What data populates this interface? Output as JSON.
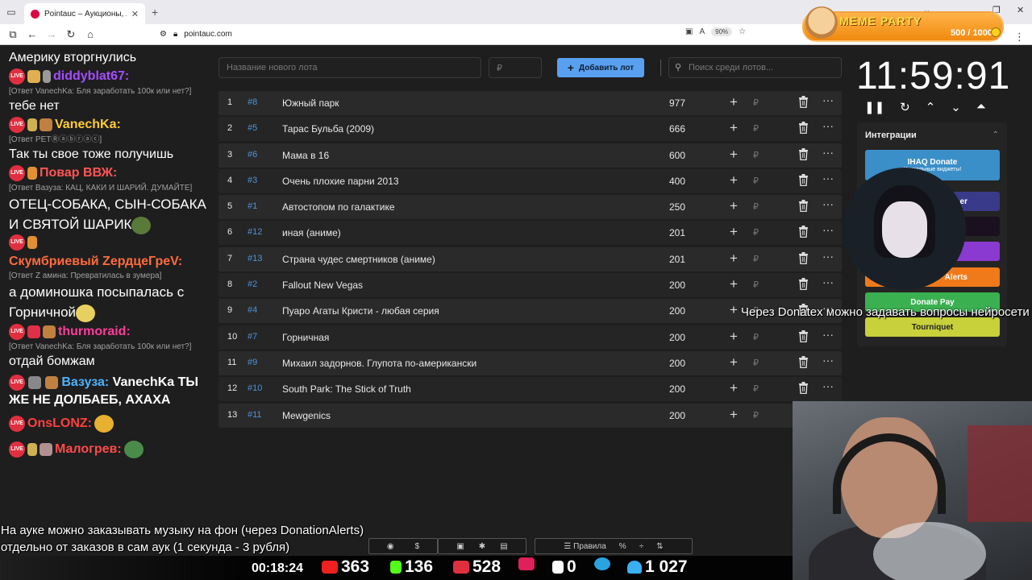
{
  "browser": {
    "tab_title": "Pointauc – Аукционы, лотереи",
    "url": "pointauc.com",
    "zoom": "90%"
  },
  "meme_party": {
    "title": "MEME PARTY",
    "count": "500 / 1000"
  },
  "chat": {
    "messages": [
      {
        "type": "text",
        "text": "Америку вторгнулись"
      },
      {
        "type": "user",
        "name": "diddyblat67:",
        "color": "#a64dff"
      },
      {
        "type": "reply",
        "text": "[Ответ VanechKa: Бля заработать 100к или нет?]"
      },
      {
        "type": "text",
        "text": "тебе нет"
      },
      {
        "type": "user",
        "name": "VanechKa:",
        "color": "#ffcc33"
      },
      {
        "type": "reply",
        "text": "[Ответ PETⓇⓐⓑⓡⓐⓒ]"
      },
      {
        "type": "text",
        "text": "Так ты свое тоже получишь"
      },
      {
        "type": "user",
        "name": "Повар ВВЖ:",
        "color": "#ff5555"
      },
      {
        "type": "reply",
        "text": "[Ответ Вазуза: КАЦ, КАКИ И ШАРИЙ. ДУМАЙТЕ]"
      },
      {
        "type": "text",
        "text": "ОТЕЦ-СОБАКА, СЫН-СОБАКА И СВЯТОЙ ШАРИК"
      },
      {
        "type": "user",
        "name": "Скумбриевый ZeрдцеГреV:",
        "color": "#ff6b3d"
      },
      {
        "type": "reply",
        "text": "[Ответ Z амина: Превратилась в зумера]"
      },
      {
        "type": "text",
        "text": "а доминошка посыпалась с Горничной"
      },
      {
        "type": "user",
        "name": "thurmoraid:",
        "color": "#ff3d9a"
      },
      {
        "type": "reply",
        "text": "[Ответ VanechKa: Бля заработать 100к или нет?]"
      },
      {
        "type": "text",
        "text": "отдай бомжам"
      },
      {
        "type": "user_inline",
        "name": "Вазуза:",
        "color": "#4fb3ff",
        "text": "VanechKa ТЫ ЖЕ НЕ ДОЛБАЕБ, АХАХА"
      },
      {
        "type": "user",
        "name": "OnsLONZ:",
        "color": "#ff4040"
      },
      {
        "type": "user",
        "name": "Малогрев:",
        "color": "#ff4a4a"
      }
    ]
  },
  "app": {
    "lot_name_placeholder": "Название нового лота",
    "amount_placeholder": "₽",
    "add_button": "Добавить лот",
    "search_placeholder": "Поиск среди лотов...",
    "lots": [
      {
        "n": "1",
        "id": "#8",
        "name": "Южный парк",
        "amount": "977"
      },
      {
        "n": "2",
        "id": "#5",
        "name": "Тарас Бульба (2009)",
        "amount": "666"
      },
      {
        "n": "3",
        "id": "#6",
        "name": "Мама в 16",
        "amount": "600"
      },
      {
        "n": "4",
        "id": "#3",
        "name": "Очень плохие парни 2013",
        "amount": "400"
      },
      {
        "n": "5",
        "id": "#1",
        "name": "Автостопом по галактике",
        "amount": "250"
      },
      {
        "n": "6",
        "id": "#12",
        "name": "иная (аниме)",
        "amount": "201"
      },
      {
        "n": "7",
        "id": "#13",
        "name": "Страна чудес смертников (аниме)",
        "amount": "201"
      },
      {
        "n": "8",
        "id": "#2",
        "name": "Fallout New Vegas",
        "amount": "200"
      },
      {
        "n": "9",
        "id": "#4",
        "name": "Пуаро Агаты Кристи - любая серия",
        "amount": "200"
      },
      {
        "n": "10",
        "id": "#7",
        "name": "Горничная",
        "amount": "200"
      },
      {
        "n": "11",
        "id": "#9",
        "name": "Михаил задорнов. Глупота по-американски",
        "amount": "200"
      },
      {
        "n": "12",
        "id": "#10",
        "name": "South Park: The Stick of Truth",
        "amount": "200"
      },
      {
        "n": "13",
        "id": "#11",
        "name": "Mewgenics",
        "amount": "200"
      }
    ],
    "currency": "₽"
  },
  "timer": {
    "value": "11:59:91"
  },
  "integrations": {
    "title": "Интеграции",
    "buttons": [
      {
        "label": "IHAQ Donate",
        "sub": "Уникальные виджеты!",
        "color": "#3a8fc8"
      },
      {
        "label": "er",
        "color": "#3a3a8a"
      },
      {
        "label": "",
        "color": "#1a1020"
      },
      {
        "label": "",
        "color": "#8a3ad0"
      },
      {
        "label": "Alerts",
        "color": "#f07a1a"
      },
      {
        "label": "Donate Pay",
        "color": "#3ab050"
      },
      {
        "label": "Tourniquet",
        "color": "#c8d03a"
      }
    ]
  },
  "overlay": {
    "donatex_note": "Через Donatex можно задавать вопросы нейросети",
    "music_line1": "На ауке можно заказывать музыку на фон (через DonationAlerts)",
    "music_line2": "отдельно от заказов в сам аук (1 секунда - 3 рубля)"
  },
  "toolbar": {
    "rules": "Правила"
  },
  "stats": {
    "uptime": "00:18:24",
    "youtube": "363",
    "kick": "136",
    "live": "528",
    "rumble": "0",
    "total": "1 027"
  }
}
